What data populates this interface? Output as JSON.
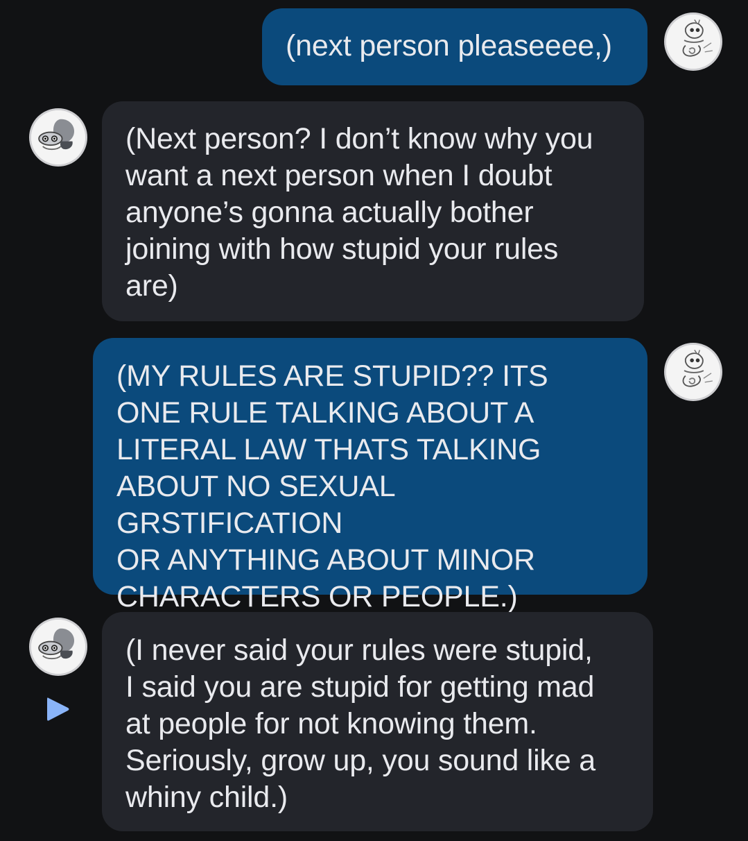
{
  "chat": {
    "messages": [
      {
        "direction": "outgoing",
        "text": "(next person pleaseeee,)",
        "avatar_icon": "sketch-character-avatar-icon"
      },
      {
        "direction": "incoming",
        "text": "(Next person? I don’t know why you\nwant a next person when I doubt\nanyone’s gonna actually bother\njoining with how stupid your rules\nare)",
        "avatar_icon": "gray-creature-avatar-icon"
      },
      {
        "direction": "outgoing",
        "text": "(MY RULES ARE STUPID?? ITS\nONE RULE TALKING ABOUT A\nLITERAL LAW THATS TALKING\nABOUT NO SEXUAL GRSTIFICATION\nOR ANYTHING ABOUT MINOR\nCHARACTERS OR PEOPLE.)",
        "avatar_icon": "sketch-character-avatar-icon"
      },
      {
        "direction": "incoming",
        "text": "(I never said your rules were stupid,\nI said you are stupid for getting mad\nat people for not knowing them.\nSeriously, grow up, you sound like a\nwhiny child.)",
        "avatar_icon": "gray-creature-avatar-icon"
      }
    ],
    "indicator_icon": "play-triangle-icon"
  },
  "colors": {
    "background": "#111214",
    "outgoing_bubble": "#0b4a7c",
    "incoming_bubble": "#23252b",
    "text": "#e9eaee",
    "indicator": "#8ab4f8"
  }
}
